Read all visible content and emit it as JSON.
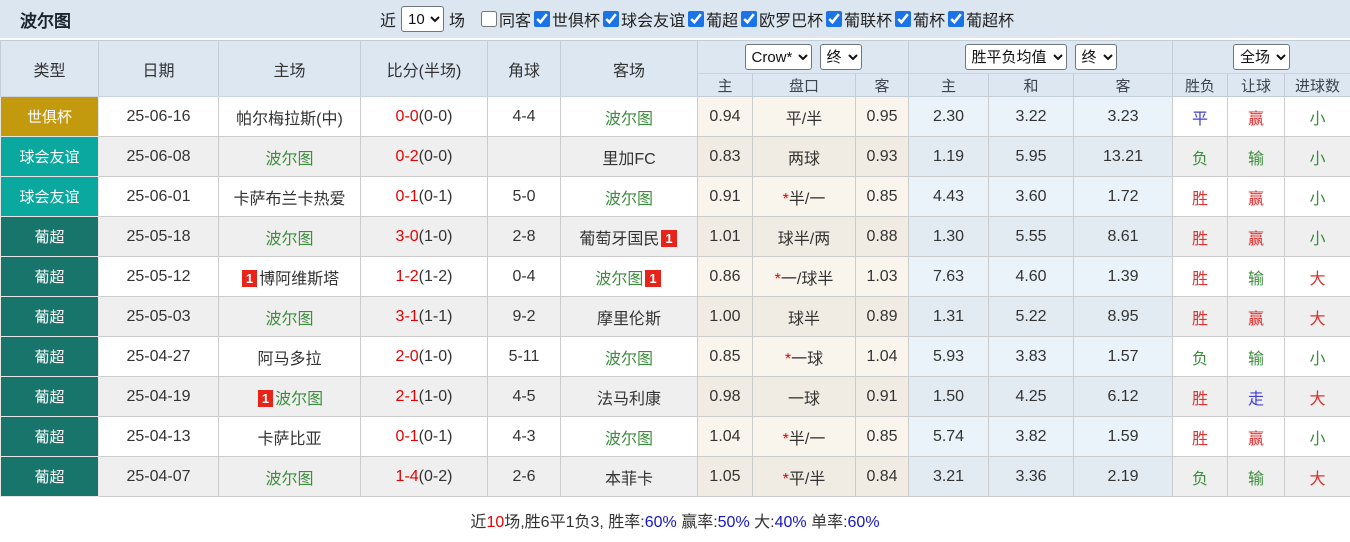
{
  "header_bar": {
    "title": "波尔图",
    "recent_label": "近",
    "recent_value": "10",
    "matches_label": "场",
    "checkboxes": [
      {
        "label": "同客",
        "checked": false
      },
      {
        "label": "世俱杯",
        "checked": true
      },
      {
        "label": "球会友谊",
        "checked": true
      },
      {
        "label": "葡超",
        "checked": true
      },
      {
        "label": "欧罗巴杯",
        "checked": true
      },
      {
        "label": "葡联杯",
        "checked": true
      },
      {
        "label": "葡杯",
        "checked": true
      },
      {
        "label": "葡超杯",
        "checked": true
      }
    ]
  },
  "table": {
    "columns": {
      "type": "类型",
      "date": "日期",
      "home": "主场",
      "score": "比分(半场)",
      "corners": "角球",
      "away": "客场"
    },
    "selects": {
      "odds_source": "Crow*",
      "odds_source_time": "终",
      "avg_source": "胜平负均值",
      "avg_source_time": "终",
      "scope": "全场"
    },
    "subheaders": [
      "主",
      "盘口",
      "客",
      "主",
      "和",
      "客",
      "胜负",
      "让球",
      "进球数"
    ],
    "type_colors": {
      "世俱杯": "#c3990e",
      "球会友谊": "#0ba8a0",
      "葡超": "#17756b"
    },
    "color_map": {
      "胜": "red",
      "平": "blue",
      "负": "green",
      "赢": "red",
      "输": "green",
      "走": "blue",
      "大": "red",
      "小": "green"
    },
    "rows": [
      {
        "type": "世俱杯",
        "date": "25-06-16",
        "home": {
          "name": "帕尔梅拉斯(中)",
          "green": false
        },
        "score": {
          "ft": "0-0",
          "ht": "(0-0)"
        },
        "corners": "4-4",
        "away": {
          "name": "波尔图",
          "green": true
        },
        "crow_home": "0.94",
        "handicap": "平/半",
        "crow_away": "0.95",
        "avg_home": "2.30",
        "avg_draw": "3.22",
        "avg_away": "3.23",
        "result": "平",
        "handicap_result": "赢",
        "goals": "小"
      },
      {
        "type": "球会友谊",
        "date": "25-06-08",
        "home": {
          "name": "波尔图",
          "green": true
        },
        "score": {
          "ft": "0-2",
          "ht": "(0-0)"
        },
        "corners": "",
        "away": {
          "name": "里加FC",
          "green": false
        },
        "crow_home": "0.83",
        "handicap": "两球",
        "crow_away": "0.93",
        "avg_home": "1.19",
        "avg_draw": "5.95",
        "avg_away": "13.21",
        "result": "负",
        "handicap_result": "输",
        "goals": "小"
      },
      {
        "type": "球会友谊",
        "date": "25-06-01",
        "home": {
          "name": "卡萨布兰卡热爱",
          "green": false
        },
        "score": {
          "ft": "0-1",
          "ht": "(0-1)"
        },
        "corners": "5-0",
        "away": {
          "name": "波尔图",
          "green": true
        },
        "crow_home": "0.91",
        "handicap": "*半/一",
        "crow_away": "0.85",
        "avg_home": "4.43",
        "avg_draw": "3.60",
        "avg_away": "1.72",
        "result": "胜",
        "handicap_result": "赢",
        "goals": "小"
      },
      {
        "type": "葡超",
        "date": "25-05-18",
        "home": {
          "name": "波尔图",
          "green": true
        },
        "score": {
          "ft": "3-0",
          "ht": "(1-0)"
        },
        "corners": "2-8",
        "away": {
          "name": "葡萄牙国民",
          "green": false,
          "badge_post": "1"
        },
        "crow_home": "1.01",
        "handicap": "球半/两",
        "crow_away": "0.88",
        "avg_home": "1.30",
        "avg_draw": "5.55",
        "avg_away": "8.61",
        "result": "胜",
        "handicap_result": "赢",
        "goals": "小"
      },
      {
        "type": "葡超",
        "date": "25-05-12",
        "home": {
          "name": "博阿维斯塔",
          "green": false,
          "badge_pre": "1"
        },
        "score": {
          "ft": "1-2",
          "ht": "(1-2)"
        },
        "corners": "0-4",
        "away": {
          "name": "波尔图",
          "green": true,
          "badge_post": "1"
        },
        "crow_home": "0.86",
        "handicap": "*一/球半",
        "crow_away": "1.03",
        "avg_home": "7.63",
        "avg_draw": "4.60",
        "avg_away": "1.39",
        "result": "胜",
        "handicap_result": "输",
        "goals": "大"
      },
      {
        "type": "葡超",
        "date": "25-05-03",
        "home": {
          "name": "波尔图",
          "green": true
        },
        "score": {
          "ft": "3-1",
          "ht": "(1-1)"
        },
        "corners": "9-2",
        "away": {
          "name": "摩里伦斯",
          "green": false
        },
        "crow_home": "1.00",
        "handicap": "球半",
        "crow_away": "0.89",
        "avg_home": "1.31",
        "avg_draw": "5.22",
        "avg_away": "8.95",
        "result": "胜",
        "handicap_result": "赢",
        "goals": "大"
      },
      {
        "type": "葡超",
        "date": "25-04-27",
        "home": {
          "name": "阿马多拉",
          "green": false
        },
        "score": {
          "ft": "2-0",
          "ht": "(1-0)"
        },
        "corners": "5-11",
        "away": {
          "name": "波尔图",
          "green": true
        },
        "crow_home": "0.85",
        "handicap": "*一球",
        "crow_away": "1.04",
        "avg_home": "5.93",
        "avg_draw": "3.83",
        "avg_away": "1.57",
        "result": "负",
        "handicap_result": "输",
        "goals": "小"
      },
      {
        "type": "葡超",
        "date": "25-04-19",
        "home": {
          "name": "波尔图",
          "green": true,
          "badge_pre": "1"
        },
        "score": {
          "ft": "2-1",
          "ht": "(1-0)"
        },
        "corners": "4-5",
        "away": {
          "name": "法马利康",
          "green": false
        },
        "crow_home": "0.98",
        "handicap": "一球",
        "crow_away": "0.91",
        "avg_home": "1.50",
        "avg_draw": "4.25",
        "avg_away": "6.12",
        "result": "胜",
        "handicap_result": "走",
        "goals": "大"
      },
      {
        "type": "葡超",
        "date": "25-04-13",
        "home": {
          "name": "卡萨比亚",
          "green": false
        },
        "score": {
          "ft": "0-1",
          "ht": "(0-1)"
        },
        "corners": "4-3",
        "away": {
          "name": "波尔图",
          "green": true
        },
        "crow_home": "1.04",
        "handicap": "*半/一",
        "crow_away": "0.85",
        "avg_home": "5.74",
        "avg_draw": "3.82",
        "avg_away": "1.59",
        "result": "胜",
        "handicap_result": "赢",
        "goals": "小"
      },
      {
        "type": "葡超",
        "date": "25-04-07",
        "home": {
          "name": "波尔图",
          "green": true
        },
        "score": {
          "ft": "1-4",
          "ht": "(0-2)"
        },
        "corners": "2-6",
        "away": {
          "name": "本菲卡",
          "green": false
        },
        "crow_home": "1.05",
        "handicap": "*平/半",
        "crow_away": "0.84",
        "avg_home": "3.21",
        "avg_draw": "3.36",
        "avg_away": "2.19",
        "result": "负",
        "handicap_result": "输",
        "goals": "大"
      }
    ]
  },
  "summary": {
    "segments": [
      {
        "text": "近",
        "color": "dark"
      },
      {
        "text": "10",
        "color": "red"
      },
      {
        "text": "场,胜6平1负3, 胜率:",
        "color": "dark"
      },
      {
        "text": "60%",
        "color": "blue"
      },
      {
        "text": " 赢率:",
        "color": "dark"
      },
      {
        "text": "50%",
        "color": "blue"
      },
      {
        "text": " 大:",
        "color": "dark"
      },
      {
        "text": "40%",
        "color": "blue"
      },
      {
        "text": " 单率:",
        "color": "dark"
      },
      {
        "text": "60%",
        "color": "blue"
      }
    ]
  }
}
